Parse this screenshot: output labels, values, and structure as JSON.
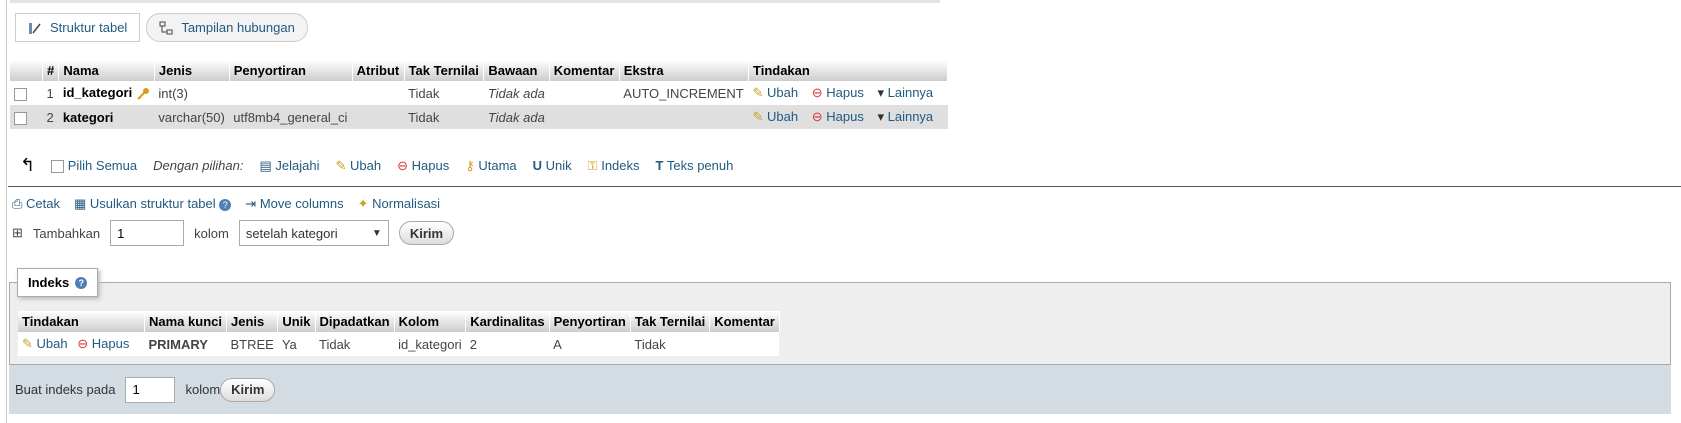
{
  "tabs": {
    "structure": "Struktur tabel",
    "relation": "Tampilan hubungan"
  },
  "columns_table": {
    "headers": [
      "#",
      "Nama",
      "Jenis",
      "Penyortiran",
      "Atribut",
      "Tak Ternilai",
      "Bawaan",
      "Komentar",
      "Ekstra",
      "Tindakan"
    ],
    "rows": [
      {
        "num": "1",
        "name": "id_kategori",
        "type": "int(3)",
        "collation": "",
        "attr": "",
        "null": "Tidak",
        "default": "Tidak ada",
        "comment": "",
        "extra": "AUTO_INCREMENT"
      },
      {
        "num": "2",
        "name": "kategori",
        "type": "varchar(50)",
        "collation": "utf8mb4_general_ci",
        "attr": "",
        "null": "Tidak",
        "default": "Tidak ada",
        "comment": "",
        "extra": ""
      }
    ],
    "actions": {
      "edit": "Ubah",
      "delete": "Hapus",
      "more": "Lainnya"
    }
  },
  "bulk": {
    "check_all": "Pilih Semua",
    "with_selected": "Dengan pilihan:",
    "browse": "Jelajahi",
    "edit": "Ubah",
    "delete": "Hapus",
    "primary": "Utama",
    "unique": "Unik",
    "index": "Indeks",
    "fulltext": "Teks penuh"
  },
  "ops": {
    "print": "Cetak",
    "propose": "Usulkan struktur tabel",
    "move": "Move columns",
    "normalize": "Normalisasi"
  },
  "add": {
    "label": "Tambahkan",
    "count": "1",
    "unit": "kolom",
    "position": "setelah kategori",
    "submit": "Kirim"
  },
  "indexes": {
    "legend": "Indeks",
    "headers": [
      "Tindakan",
      "Nama kunci",
      "Jenis",
      "Unik",
      "Dipadatkan",
      "Kolom",
      "Kardinalitas",
      "Penyortiran",
      "Tak Ternilai",
      "Komentar"
    ],
    "row": {
      "edit": "Ubah",
      "delete": "Hapus",
      "keyname": "PRIMARY",
      "type": "BTREE",
      "unique": "Ya",
      "packed": "Tidak",
      "column": "id_kategori",
      "cardinality": "2",
      "collation": "A",
      "null": "Tidak",
      "comment": ""
    },
    "create_label": "Buat indeks pada",
    "create_count": "1",
    "create_unit": "kolom",
    "create_submit": "Kirim"
  }
}
